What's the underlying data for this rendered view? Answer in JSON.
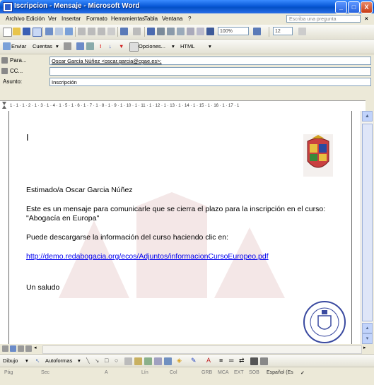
{
  "window": {
    "title": "Iscripcion - Mensaje - Microsoft Word",
    "minimize": "_",
    "maximize": "□",
    "close": "X"
  },
  "menu": {
    "items": [
      "Archivo",
      "Edición",
      "Ver",
      "Insertar",
      "Formato",
      "Herramientas",
      "Tabla",
      "Ventana",
      "?"
    ],
    "help_placeholder": "Escriba una pregunta",
    "close_doc": "×"
  },
  "toolbar_standard": {
    "zoom": "100%",
    "font_size": "12"
  },
  "toolbar_email": {
    "send_label": "Enviar",
    "accounts_label": "Cuentas",
    "options_label": "Opciones...",
    "format": "HTML"
  },
  "addresses": {
    "to_label": "Para...",
    "to_value": "Oscar García Núñez <oscar.garcia@cgae.es>;",
    "cc_label": "CC...",
    "cc_value": "",
    "subject_label": "Asunto:",
    "subject_value": "Inscripción"
  },
  "ruler": {
    "text": "1 · 1 · 1 · 2 · 1 · 3 · 1 · 4 · 1 · 5 · 1 · 6 · 1 · 7 · 1 · 8 · 1 · 9 · 1 · 10 · 1 · 11 · 1 · 12 · 1 · 13 · 1 · 14 · 1 · 15 · 1 · 16 · 1 · 17 · 1"
  },
  "document": {
    "cursor": "I",
    "greeting": "Estimado/a Oscar Garcia Núñez",
    "paragraph1_line1": "Este es un mensaje para comunicarle que se cierra el plazo para la inscripción en el curso:",
    "paragraph1_line2": "\"Abogacía en Europa\"",
    "paragraph2": "Puede descargarse la información del curso haciendo clic en:",
    "link": "http://demo.redabogacia.org/ecos/Adjuntos/informacionCursoEuropeo.pdf",
    "closing": "Un saludo"
  },
  "drawing_toolbar": {
    "draw_label": "Dibujo",
    "autoshapes_label": "Autoformas"
  },
  "status_bar": {
    "page": "Pág",
    "section": "Sec",
    "position": "A",
    "line": "Lín",
    "column": "Col",
    "rec": "GRB",
    "trk": "MCA",
    "ext": "EXT",
    "ovr": "SOB",
    "language": "Español (Es",
    "spell": "✓"
  },
  "colors": {
    "titlebar": "#0a5ad8",
    "chrome": "#ece9d8",
    "link": "#0000ee"
  }
}
